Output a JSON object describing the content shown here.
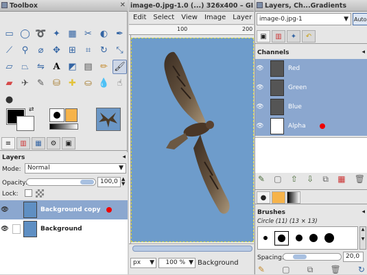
{
  "toolbox": {
    "title": "Toolbox",
    "tools": [
      "rect-select",
      "ellipse-select",
      "free-select",
      "fuzzy-select",
      "by-color-select",
      "scissors",
      "foreground-select",
      "paths",
      "color-picker",
      "zoom",
      "measure",
      "move",
      "align",
      "crop",
      "rotate",
      "scale",
      "shear",
      "perspective",
      "flip",
      "text",
      "bucket-fill",
      "blend",
      "pencil",
      "paintbrush",
      "eraser",
      "airbrush",
      "ink",
      "clone",
      "heal",
      "perspective-clone",
      "blur",
      "smudge",
      "dodge-burn"
    ],
    "active_tool": "paintbrush"
  },
  "layers_panel": {
    "title": "Layers",
    "mode_label": "Mode:",
    "mode_value": "Normal",
    "opacity_label": "Opacity:",
    "opacity_value": "100,0",
    "opacity_fraction": 1.0,
    "lock_label": "Lock:",
    "layers": [
      {
        "name": "Background copy",
        "selected": true
      },
      {
        "name": "Background",
        "selected": false
      }
    ]
  },
  "image_window": {
    "title": "image-0.jpg-1.0 (...) 326x400 – GI",
    "menus": [
      "Edit",
      "Select",
      "View",
      "Image",
      "Layer"
    ],
    "ruler_labels": [
      "100",
      "200"
    ],
    "unit": "px",
    "zoom": "100 %",
    "status_text": "Background"
  },
  "dock": {
    "title": "Layers, Ch...Gradients",
    "image_select": "image-0.jpg-1",
    "auto_button": "Auto",
    "channels_title": "Channels",
    "channels": [
      "Red",
      "Green",
      "Blue",
      "Alpha"
    ],
    "brushes_title": "Brushes",
    "brush_name": "Circle (11) (13 × 13)",
    "spacing_label": "Spacing:",
    "spacing_value": "20,0",
    "spacing_fraction": 0.2
  },
  "colors": {
    "accent": "#8ba7cf",
    "selection": "#8ba7cf",
    "sky": "#6e9ccb",
    "red_dot": "#e00000"
  }
}
